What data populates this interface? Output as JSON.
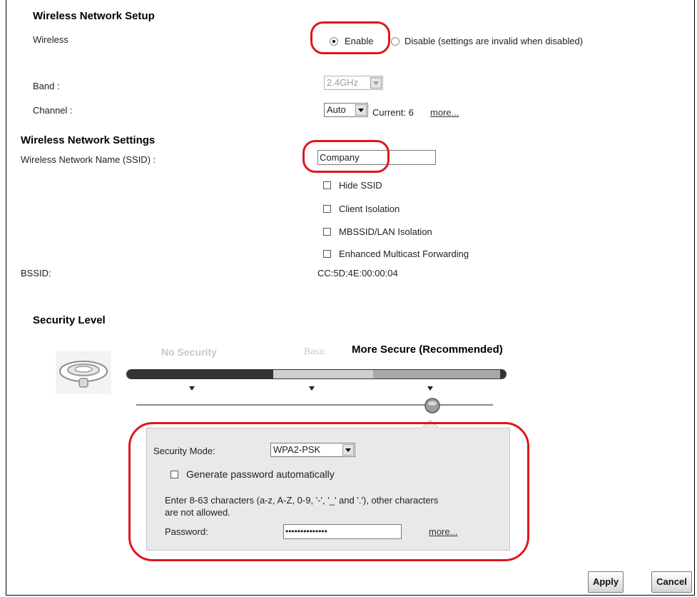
{
  "setup": {
    "heading": "Wireless Network Setup",
    "wireless_label": "Wireless",
    "enable_label": "Enable",
    "disable_label": "Disable (settings are invalid when disabled)",
    "band_label": "Band :",
    "band_value": "2.4GHz",
    "channel_label": "Channel :",
    "channel_value": "Auto",
    "current_channel": "Current: 6",
    "more_link": "more..."
  },
  "settings": {
    "heading": "Wireless Network Settings",
    "ssid_label": "Wireless Network Name (SSID) :",
    "ssid_value": "Company",
    "options": [
      {
        "label": "Hide SSID",
        "checked": false
      },
      {
        "label": "Client Isolation",
        "checked": false
      },
      {
        "label": "MBSSID/LAN Isolation",
        "checked": false
      },
      {
        "label": "Enhanced Multicast Forwarding",
        "checked": false
      }
    ],
    "bssid_label": "BSSID:",
    "bssid_value": "CC:5D:4E:00:00:04"
  },
  "security": {
    "heading": "Security Level",
    "levels": [
      "No Security",
      "Basic",
      "More Secure (Recommended)"
    ],
    "selected_level": "More Secure (Recommended)",
    "mode_label": "Security Mode:",
    "mode_value": "WPA2-PSK",
    "generate_label": "Generate password automatically",
    "hint_line1": "Enter 8-63 characters (a-z, A-Z, 0-9, '-', '_' and '.'), other characters",
    "hint_line2": "are not allowed.",
    "password_label": "Password:",
    "password_value": "••••••••••••••",
    "more_link": "more..."
  },
  "buttons": {
    "apply": "Apply",
    "cancel": "Cancel"
  },
  "colors": {
    "callout": "#e0161e"
  }
}
